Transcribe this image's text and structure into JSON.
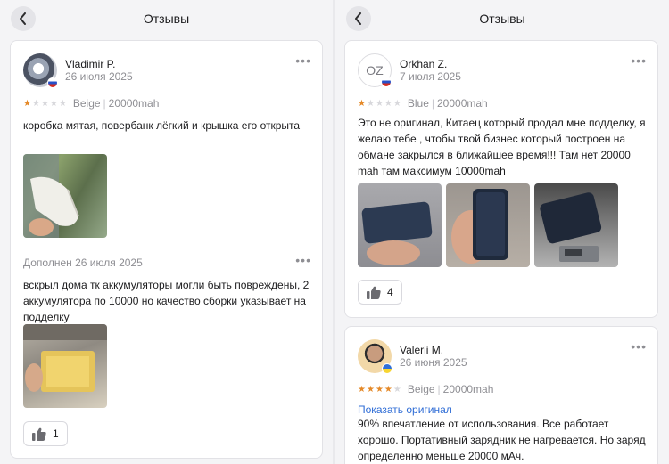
{
  "left": {
    "title": "Отзывы",
    "review": {
      "name": "Vladimir P.",
      "date": "26 июля 2025",
      "stars": 1,
      "color": "Beige",
      "capacity": "20000mah",
      "text": "коробка мятая, повербанк лёгкий и крышка его открыта",
      "addon_label": "Дополнен 26 июля 2025",
      "addon_text": "вскрыл дома тк аккумуляторы могли быть повреждены, 2 аккумулятора по 10000 но качество сборки указывает на подделку",
      "likes": "1"
    }
  },
  "right": {
    "title": "Отзывы",
    "review1": {
      "initials": "OZ",
      "name": "Orkhan Z.",
      "date": "7 июля 2025",
      "stars": 1,
      "color": "Blue",
      "capacity": "20000mah",
      "text": "Это не оригинал, Китаец который продал мне подделку, я желаю тебе , чтобы твой бизнес который построен на обмане закрылся в ближайшее время!!! Там нет 20000 mah там максимум 10000mah",
      "likes": "4"
    },
    "review2": {
      "name": "Valerii M.",
      "date": "26 июня 2025",
      "stars": 4,
      "color": "Beige",
      "capacity": "20000mah",
      "show_original": "Показать оригинал",
      "text": "90% впечатление от использования. Все работает хорошо. Портативный зарядник не нагревается. Но заряд определенно меньше 20000 мАч."
    }
  },
  "colors": {
    "star_on": "#e58a2a",
    "link": "#2f6dd6"
  }
}
